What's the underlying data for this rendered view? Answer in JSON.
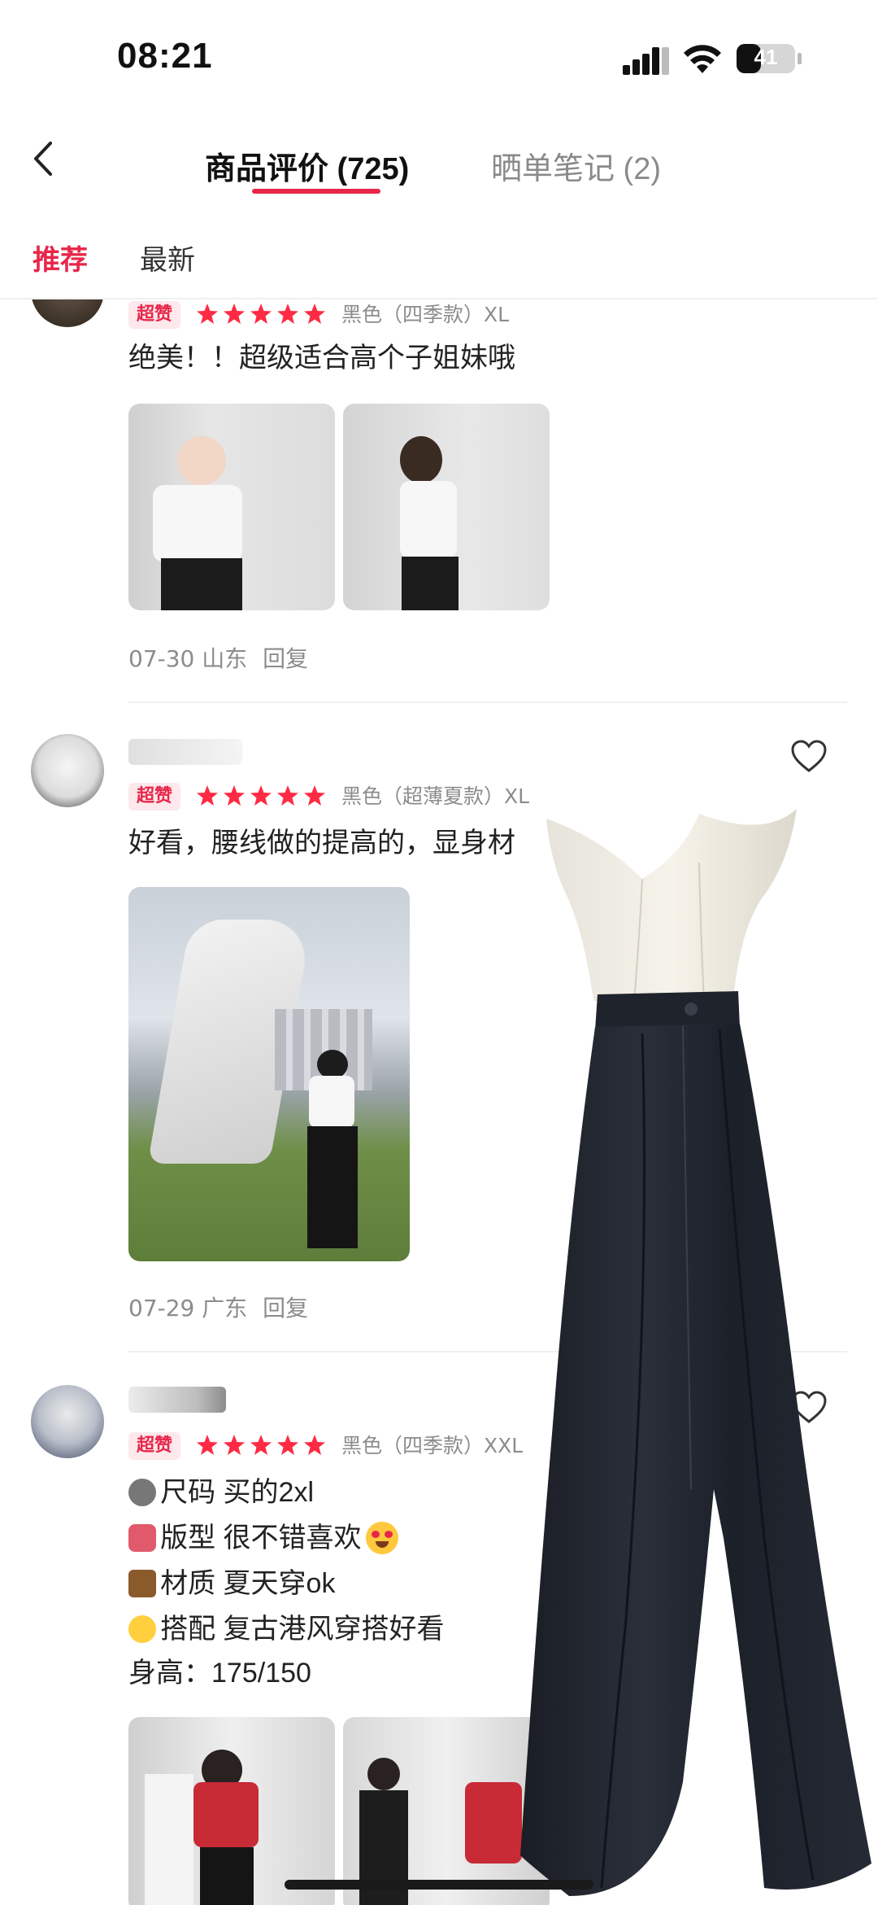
{
  "status_bar": {
    "time": "08:21",
    "battery": "41"
  },
  "header": {
    "tabs": [
      {
        "label": "商品评价 (725)",
        "active": true
      },
      {
        "label": "晒单笔记 (2)",
        "active": false
      }
    ]
  },
  "sort_tabs": [
    {
      "label": "推荐",
      "active": true
    },
    {
      "label": "最新",
      "active": false
    }
  ],
  "colors": {
    "accent": "#e8264a",
    "badge_bg": "#fde8ec",
    "muted": "#8c8c8c"
  },
  "reviews": [
    {
      "badge": "超赞",
      "rating": 5,
      "spec": "黑色（四季款）XL",
      "lines": [
        "绝美！！超级适合高个子姐妹哦"
      ],
      "date_location": "07-30 山东",
      "reply": "回复"
    },
    {
      "badge": "超赞",
      "rating": 5,
      "spec": "黑色（超薄夏款）XL",
      "lines": [
        "好看，腰线做的提高的，显身材"
      ],
      "date_location": "07-29 广东",
      "reply": "回复"
    },
    {
      "badge": "超赞",
      "rating": 5,
      "spec": "黑色（四季款）XXL",
      "lines": [
        "尺码 买的2xl",
        "版型 很不错喜欢",
        "材质 夏天穿ok",
        "搭配 复古港风穿搭好看",
        "身高：175/150"
      ]
    }
  ],
  "icons": [
    "back-arrow-icon",
    "heart-icon",
    "star-icon",
    "signal-icon",
    "wifi-icon",
    "battery-icon"
  ]
}
